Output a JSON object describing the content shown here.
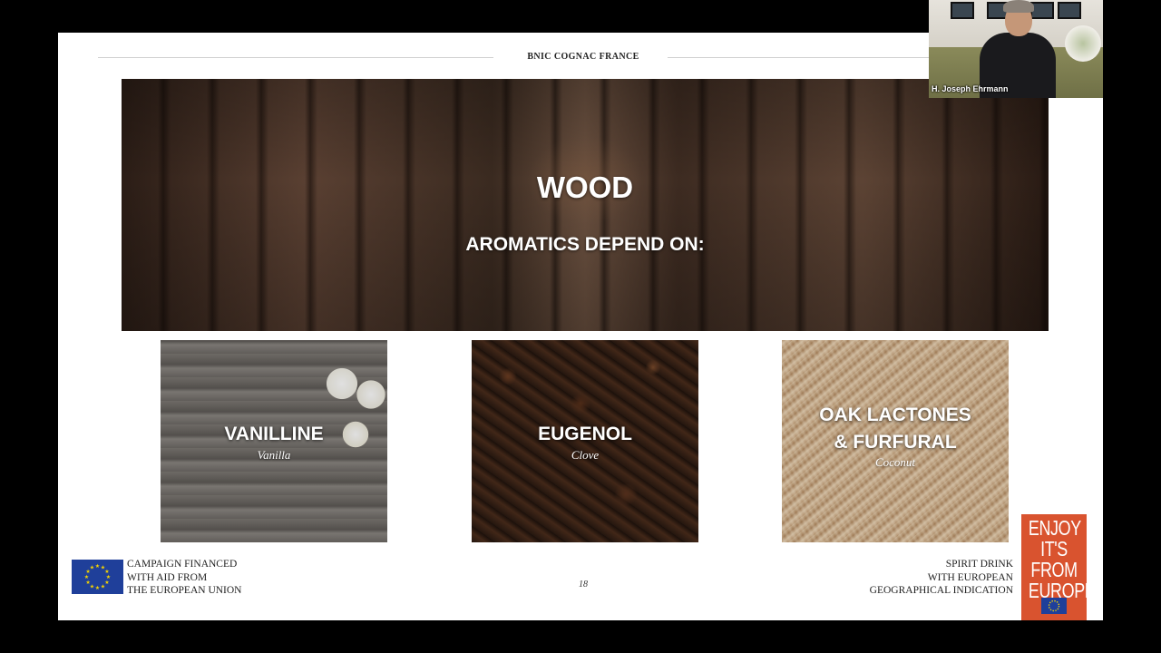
{
  "slide": {
    "header": "BNIC COGNAC FRANCE",
    "hero": {
      "title": "WOOD",
      "subtitle": "AROMATICS DEPEND ON:"
    },
    "cards": [
      {
        "name": "VANILLINE",
        "subtitle": "Vanilla"
      },
      {
        "name": "EUGENOL",
        "subtitle": "Clove"
      },
      {
        "name": "OAK LACTONES\n& FURFURAL",
        "subtitle": "Coconut"
      }
    ],
    "footer": {
      "campaign_lines": [
        "CAMPAIGN FINANCED",
        "WITH AID FROM",
        "THE EUROPEAN UNION"
      ],
      "page_number": "18",
      "gi_lines": [
        "SPIRIT DRINK",
        "WITH EUROPEAN",
        "GEOGRAPHICAL INDICATION"
      ],
      "badge_lines": [
        "ENJOY",
        "IT'S FROM",
        "EUROPE"
      ]
    }
  },
  "video": {
    "participant_name": "H. Joseph Ehrmann"
  },
  "colors": {
    "eu_blue": "#1f3f9a",
    "eu_star": "#f5d400",
    "badge_orange": "#d9532f"
  }
}
